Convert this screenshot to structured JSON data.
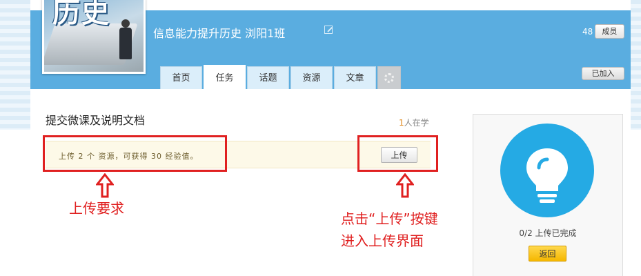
{
  "header": {
    "cover_text": "历史",
    "class_title": "信息能力提升历史 浏阳1班",
    "member_count": "48",
    "members_label": "成员",
    "joined_label": "已加入"
  },
  "tabs": [
    {
      "label": "首页"
    },
    {
      "label": "任务"
    },
    {
      "label": "话题"
    },
    {
      "label": "资源"
    },
    {
      "label": "文章"
    }
  ],
  "task": {
    "title": "提交微课及说明文档",
    "learners_count": "1",
    "learners_suffix": "人在学",
    "requirement": "上传 2 个 资源，可获得 30 经验值。",
    "upload_label": "上传"
  },
  "annotations": {
    "requirement_note": "上传要求",
    "upload_note_line1": "点击“上传”按键",
    "upload_note_line2": "进入上传界面"
  },
  "side": {
    "progress": "0/2 上传已完成",
    "back_label": "返回"
  },
  "colors": {
    "header_blue": "#5aade0",
    "annotation_red": "#e02020",
    "bulb_blue": "#25aae4",
    "back_button": "#f5b700"
  }
}
